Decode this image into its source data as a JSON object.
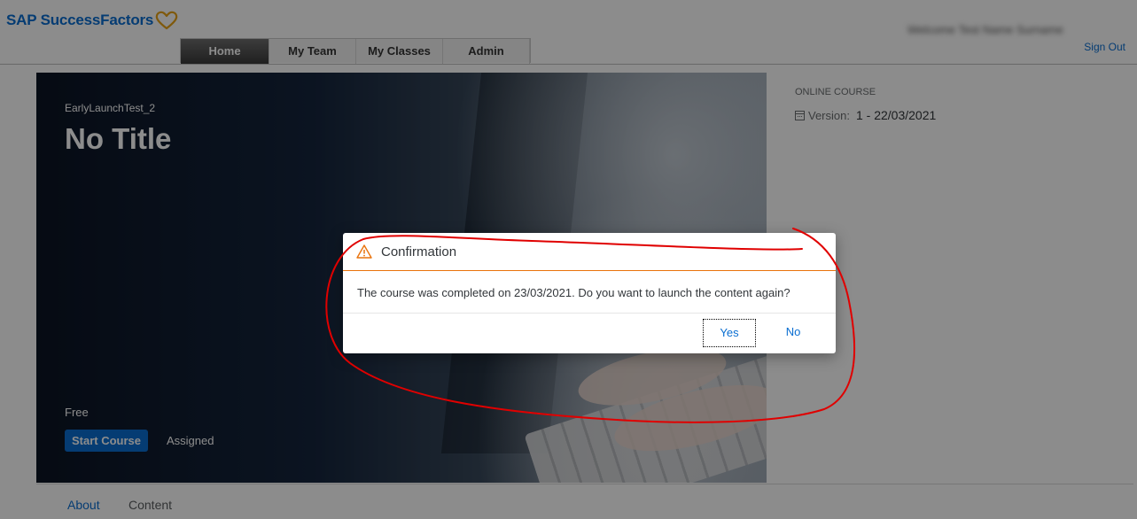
{
  "header": {
    "logo_text": "SAP SuccessFactors",
    "nav": [
      {
        "label": "Home",
        "active": true
      },
      {
        "label": "My Team",
        "active": false
      },
      {
        "label": "My Classes",
        "active": false
      },
      {
        "label": "Admin",
        "active": false
      }
    ],
    "welcome_text": "Welcome Test Name Surname",
    "sign_out": "Sign Out"
  },
  "course": {
    "code": "EarlyLaunchTest_2",
    "title": "No Title",
    "price": "Free",
    "start_button": "Start Course",
    "status": "Assigned",
    "type_label": "ONLINE COURSE",
    "version_label": "Version:",
    "version_value": "1 - 22/03/2021"
  },
  "tabs": {
    "about": "About",
    "content": "Content"
  },
  "dialog": {
    "title": "Confirmation",
    "message": "The course was completed on 23/03/2021. Do you want to launch the content again?",
    "yes": "Yes",
    "no": "No"
  },
  "colors": {
    "brand_blue": "#0a6ed1",
    "warning_orange": "#e9730c",
    "annotation_red": "#e00000"
  },
  "icons": {
    "logo": "heart-icon",
    "warning": "warning-triangle-icon",
    "version": "calendar-icon"
  }
}
